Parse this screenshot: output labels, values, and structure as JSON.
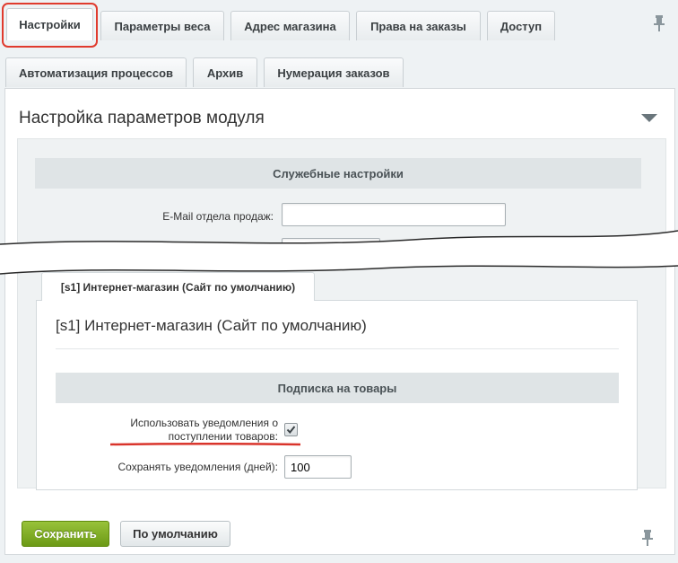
{
  "tabs_row1": [
    {
      "label": "Настройки",
      "active": true
    },
    {
      "label": "Параметры веса",
      "active": false
    },
    {
      "label": "Адрес магазина",
      "active": false
    },
    {
      "label": "Права на заказы",
      "active": false
    },
    {
      "label": "Доступ",
      "active": false
    }
  ],
  "tabs_row2": [
    {
      "label": "Автоматизация процессов"
    },
    {
      "label": "Архив"
    },
    {
      "label": "Нумерация заказов"
    }
  ],
  "panel": {
    "title": "Настройка параметров модуля",
    "service_section": {
      "heading": "Служебные настройки",
      "email_label": "E-Mail отдела продаж:",
      "email_value": "",
      "next_field_value": ""
    },
    "site_tab": {
      "label": "[s1] Интернет-магазин (Сайт по умолчанию)",
      "title": "[s1] Интернет-магазин (Сайт по умолчанию)"
    },
    "subscription_section": {
      "heading": "Подписка на товары",
      "notify_label_line1": "Использовать уведомления о",
      "notify_label_line2": "поступлении товаров:",
      "notify_checked": true,
      "keep_days_label": "Сохранять уведомления (дней):",
      "keep_days_value": "100"
    }
  },
  "buttons": {
    "save_label": "Сохранить",
    "default_label": "По умолчанию"
  },
  "colors": {
    "highlight": "#e03b2e",
    "save_button": "#7aa524"
  },
  "icons": [
    "pin-icon",
    "collapse-arrow-icon",
    "check-icon"
  ]
}
